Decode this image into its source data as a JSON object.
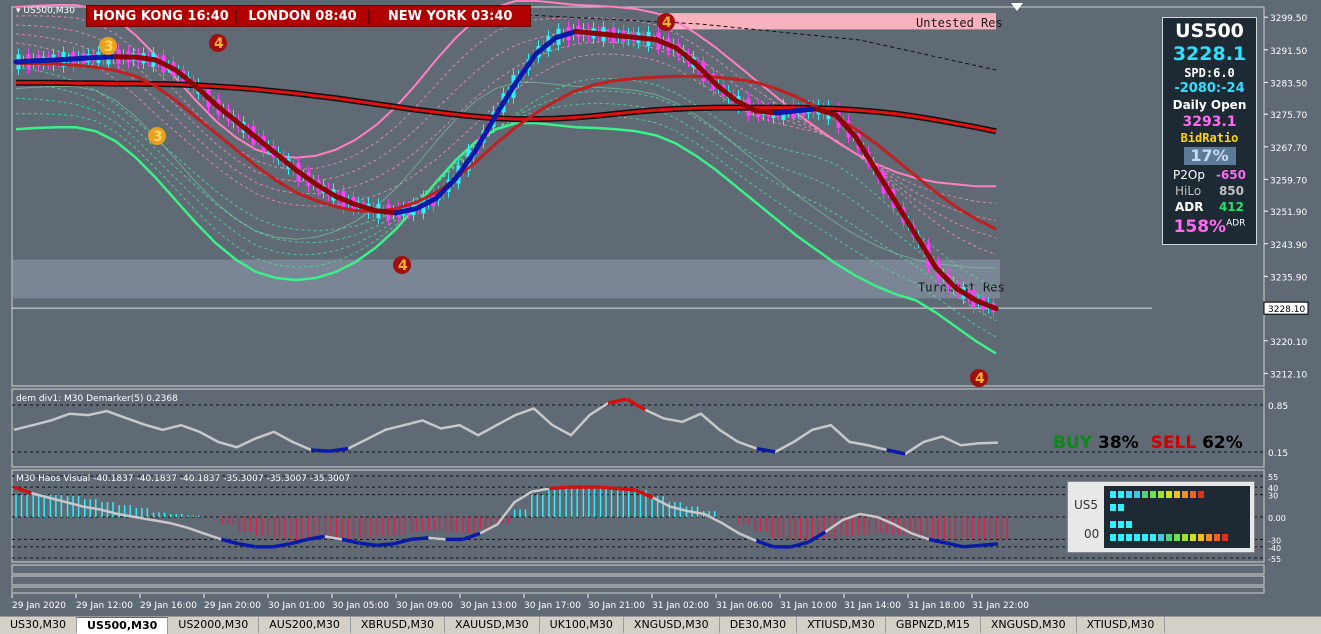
{
  "symbol_label": "US500,M30",
  "clocks": [
    "HONG KONG 16:40",
    "LONDON 08:40",
    "NEW YORK 03:40"
  ],
  "chart_data": {
    "type": "line",
    "title": "US500,M30",
    "ylim": [
      3209,
      3302
    ],
    "y_ticks": [
      "3299.50",
      "3291.50",
      "3283.50",
      "3275.70",
      "3267.70",
      "3259.70",
      "3251.90",
      "3243.90",
      "3235.90",
      "3228.10",
      "3220.10",
      "3212.10"
    ],
    "x_ticks": [
      "29 Jan 2020",
      "29 Jan 12:00",
      "29 Jan 16:00",
      "29 Jan 20:00",
      "30 Jan 01:00",
      "30 Jan 05:00",
      "30 Jan 09:00",
      "30 Jan 13:00",
      "30 Jan 17:00",
      "30 Jan 21:00",
      "31 Jan 02:00",
      "31 Jan 06:00",
      "31 Jan 10:00",
      "31 Jan 14:00",
      "31 Jan 18:00",
      "31 Jan 22:00"
    ],
    "current_price": "3228.10",
    "zones": [
      {
        "label": "Untested Res",
        "from": 3296.5,
        "to": 3300.5,
        "color": "#ffb6c1"
      },
      {
        "label": "Turncoat Res",
        "from": 3230.5,
        "to": 3240.0,
        "color": "#7d8a99"
      }
    ],
    "markers": [
      "3",
      "3",
      "4",
      "4",
      "4",
      "4"
    ],
    "series": [
      {
        "values": [
          3288.5,
          3288.8,
          3289.0,
          3289.3,
          3289.6,
          3289.8,
          3289.7,
          3289.0,
          3286.5,
          3282.5,
          3278.0,
          3274.0,
          3270.0,
          3266.0,
          3262.0,
          3258.5,
          3255.5,
          3253.5,
          3252.0,
          3251.5,
          3252.5,
          3255.0,
          3260.0,
          3267.0,
          3275.5,
          3283.5,
          3290.5,
          3294.5,
          3296.0,
          3295.5,
          3295.0,
          3294.5,
          3294.0,
          3292.0,
          3288.0,
          3283.0,
          3279.0,
          3276.5,
          3276.0,
          3276.5,
          3277.0,
          3275.5,
          3270.0,
          3262.0,
          3254.0,
          3246.0,
          3238.0,
          3233.0,
          3230.0,
          3228.0
        ]
      },
      {
        "values": [
          3283.4,
          3283.4,
          3283.4,
          3283.3,
          3283.3,
          3283.2,
          3283.2,
          3283.1,
          3283.0,
          3282.8,
          3282.5,
          3282.2,
          3281.8,
          3281.3,
          3280.8,
          3280.2,
          3279.6,
          3278.9,
          3278.2,
          3277.5,
          3276.8,
          3276.2,
          3275.6,
          3275.1,
          3274.7,
          3274.5,
          3274.5,
          3274.6,
          3274.9,
          3275.3,
          3275.8,
          3276.3,
          3276.7,
          3277.0,
          3277.2,
          3277.3,
          3277.3,
          3277.3,
          3277.3,
          3277.3,
          3277.2,
          3277.0,
          3276.7,
          3276.3,
          3275.8,
          3275.1,
          3274.3,
          3273.4,
          3272.5,
          3271.5
        ]
      },
      {
        "values": [
          3291.0,
          3290.0,
          3288.5,
          3286.5,
          3284.0,
          3280.5,
          3276.5,
          3272.0,
          3268.0,
          3264.0,
          3260.0,
          3256.5,
          3253.5,
          3251.5,
          3250.5,
          3250.0,
          3250.0,
          3250.5,
          3251.5,
          3253.0,
          3255.5,
          3258.5,
          3262.5,
          3267.0,
          3272.0,
          3276.5,
          3280.5,
          3284.0,
          3286.5,
          3287.5,
          3287.5,
          3287.0,
          3286.0,
          3284.0,
          3281.0,
          3278.0,
          3275.0,
          3273.0,
          3272.0,
          3271.5,
          3271.0,
          3269.5,
          3266.0,
          3261.5,
          3256.5,
          3251.0,
          3246.5,
          3242.5,
          3239.5,
          3237.0
        ]
      },
      {
        "values": [
          3288.2,
          3288.1,
          3288.0,
          3287.7,
          3287.2,
          3286.4,
          3285.0,
          3282.5,
          3279.0,
          3275.0,
          3271.0,
          3267.0,
          3263.0,
          3259.5,
          3256.5,
          3254.5,
          3253.0,
          3252.0,
          3251.8,
          3252.5,
          3254.0,
          3256.5,
          3260.0,
          3264.0,
          3268.5,
          3272.5,
          3276.0,
          3279.0,
          3281.5,
          3283.0,
          3284.0,
          3284.5,
          3284.8,
          3285.0,
          3285.0,
          3284.8,
          3284.3,
          3283.5,
          3282.0,
          3280.0,
          3277.5,
          3275.0,
          3272.0,
          3268.5,
          3264.5,
          3260.5,
          3256.5,
          3253.0,
          3250.0,
          3247.5
        ]
      },
      {
        "values": [
          3302.0,
          3302.3,
          3302.5,
          3302.5,
          3301.5,
          3299.0,
          3295.0,
          3290.0,
          3284.5,
          3279.0,
          3274.0,
          3270.0,
          3267.0,
          3265.5,
          3265.0,
          3265.5,
          3267.0,
          3269.5,
          3273.0,
          3277.5,
          3283.0,
          3289.0,
          3294.5,
          3299.0,
          3302.0,
          3303.5,
          3303.5,
          3303.0,
          3302.5,
          3302.3,
          3302.0,
          3301.5,
          3300.5,
          3298.5,
          3295.5,
          3292.0,
          3288.0,
          3284.0,
          3280.0,
          3276.0,
          3272.5,
          3269.0,
          3266.0,
          3263.5,
          3261.5,
          3260.0,
          3259.0,
          3258.5,
          3258.0,
          3258.0
        ]
      },
      {
        "values": [
          3282.0,
          3282.3,
          3282.5,
          3282.5,
          3281.5,
          3279.0,
          3275.0,
          3270.0,
          3264.5,
          3259.0,
          3254.0,
          3250.0,
          3247.0,
          3245.5,
          3245.0,
          3245.5,
          3247.0,
          3249.5,
          3253.0,
          3257.5,
          3263.0,
          3269.0,
          3274.5,
          3279.0,
          3282.0,
          3283.5,
          3283.5,
          3283.0,
          3282.5,
          3282.3,
          3282.0,
          3281.5,
          3280.5,
          3278.5,
          3275.5,
          3272.0,
          3268.0,
          3264.0,
          3260.0,
          3256.0,
          3252.5,
          3249.0,
          3246.0,
          3243.5,
          3241.5,
          3240.0,
          3239.0,
          3238.5,
          3238.0,
          3238.0
        ]
      },
      {
        "values": [
          3272.0,
          3272.3,
          3272.5,
          3272.5,
          3271.5,
          3269.0,
          3265.0,
          3260.0,
          3254.5,
          3249.0,
          3244.0,
          3240.0,
          3237.0,
          3235.5,
          3235.0,
          3235.5,
          3237.0,
          3239.5,
          3243.0,
          3247.5,
          3253.0,
          3259.0,
          3264.5,
          3269.0,
          3272.0,
          3273.5,
          3273.5,
          3273.0,
          3272.5,
          3272.3,
          3272.0,
          3271.5,
          3270.5,
          3268.5,
          3265.5,
          3262.0,
          3258.0,
          3254.0,
          3250.0,
          3246.0,
          3242.5,
          3239.0,
          3236.0,
          3233.5,
          3231.5,
          3230.0,
          3227.0,
          3223.5,
          3220.0,
          3217.0
        ]
      }
    ]
  },
  "info_panel": {
    "title": "US500",
    "price": "3228.1",
    "spread": "SPD:6.0",
    "change": "-2080:-24",
    "daily_open_label": "Daily Open",
    "daily_open": "3293.1",
    "bid_ratio_label": "BidRatio",
    "bid_ratio": "17%",
    "p2op_label": "P2Op",
    "p2op": "-650",
    "hilo_label": "HiLo",
    "hilo": "850",
    "adr_label": "ADR",
    "adr": "412",
    "adr_pct": "158%",
    "adr_suffix": "ADR"
  },
  "demarker_panel": {
    "label": "dem div1: M30  Demarker(5) 0.2368",
    "levels": [
      "0.85",
      "0.15"
    ],
    "values": [
      0.48,
      0.55,
      0.62,
      0.72,
      0.7,
      0.76,
      0.66,
      0.56,
      0.48,
      0.55,
      0.45,
      0.3,
      0.22,
      0.35,
      0.45,
      0.3,
      0.18,
      0.16,
      0.2,
      0.34,
      0.48,
      0.55,
      0.62,
      0.5,
      0.55,
      0.4,
      0.55,
      0.7,
      0.8,
      0.55,
      0.4,
      0.7,
      0.88,
      0.94,
      0.78,
      0.65,
      0.6,
      0.72,
      0.48,
      0.3,
      0.2,
      0.15,
      0.3,
      0.48,
      0.55,
      0.3,
      0.25,
      0.18,
      0.12,
      0.3,
      0.38,
      0.25,
      0.28,
      0.29
    ],
    "buy_label": "BUY",
    "buy_pct": "38%",
    "sell_label": "SELL",
    "sell_pct": "62%"
  },
  "haos_panel": {
    "label": "M30 Haos Visual -40.1837 -40.1837 -40.1837 -35.3007 -35.3007 -35.3007",
    "levels": [
      "55",
      "40",
      "30",
      "0.00",
      "-30",
      "-40",
      "-55"
    ],
    "line": [
      40,
      32,
      26,
      20,
      14,
      10,
      4,
      0,
      -4,
      -8,
      -14,
      -22,
      -30,
      -36,
      -40,
      -40,
      -36,
      -30,
      -26,
      -30,
      -35,
      -38,
      -36,
      -30,
      -28,
      -30,
      -30,
      -22,
      -10,
      20,
      34,
      38,
      40,
      40,
      40,
      38,
      36,
      26,
      14,
      8,
      4,
      -8,
      -22,
      -32,
      -40,
      -40,
      -34,
      -20,
      -4,
      4,
      0,
      -10,
      -22,
      -30,
      -35,
      -40,
      -38,
      -36
    ],
    "bars": [
      30,
      30,
      30,
      28,
      24,
      20,
      16,
      12,
      6,
      4,
      2,
      0,
      -10,
      -20,
      -26,
      -30,
      -32,
      -30,
      -30,
      -30,
      -28,
      -26,
      -24,
      -20,
      -18,
      -20,
      -22,
      -16,
      -8,
      10,
      30,
      38,
      40,
      40,
      40,
      38,
      36,
      28,
      20,
      14,
      8,
      0,
      -10,
      -20,
      -28,
      -30,
      -30,
      -28,
      -26,
      -24,
      -22,
      -24,
      -26,
      -28,
      -30,
      -30,
      -30,
      -30
    ],
    "widget_labels": [
      "US5",
      "00"
    ]
  },
  "tabs": [
    "US30,M30",
    "US500,M30",
    "US2000,M30",
    "AUS200,M30",
    "XBRUSD,M30",
    "XAUUSD,M30",
    "UK100,M30",
    "XNGUSD,M30",
    "DE30,M30",
    "XTIUSD,M30",
    "GBPNZD,M15",
    "XNGUSD,M30",
    "XTIUSD,M30"
  ],
  "active_tab": 1
}
